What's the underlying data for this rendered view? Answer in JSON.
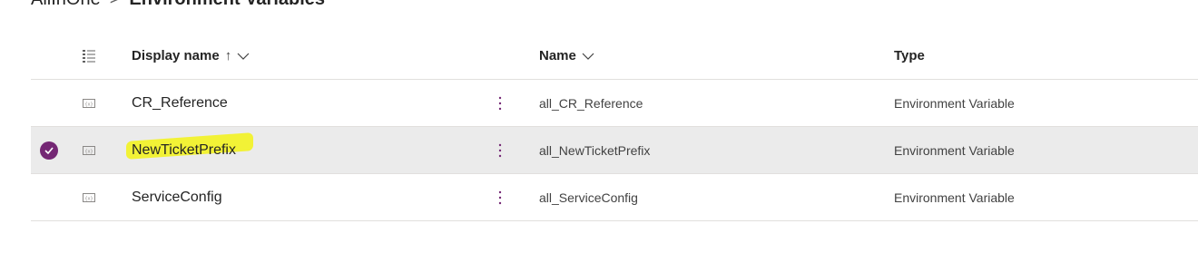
{
  "breadcrumb": {
    "parent": "AllInOne",
    "separator": ">",
    "current": "Environment Variables"
  },
  "columns": {
    "display_name": {
      "label": "Display name",
      "sort_indicator": "↑"
    },
    "name": {
      "label": "Name"
    },
    "type": {
      "label": "Type"
    }
  },
  "rows": [
    {
      "display_name": "CR_Reference",
      "name": "all_CR_Reference",
      "type": "Environment Variable",
      "selected": false
    },
    {
      "display_name": "NewTicketPrefix",
      "name": "all_NewTicketPrefix",
      "type": "Environment Variable",
      "selected": true
    },
    {
      "display_name": "ServiceConfig",
      "name": "all_ServiceConfig",
      "type": "Environment Variable",
      "selected": false
    }
  ],
  "colors": {
    "accent": "#742774",
    "selected_row": "#ebebeb",
    "highlight": "#f3f316"
  },
  "icons": {
    "header": "column-options-icon",
    "row": "environment-variable-icon",
    "more": "more-vertical-icon",
    "selected": "checkmark-circle-icon"
  }
}
